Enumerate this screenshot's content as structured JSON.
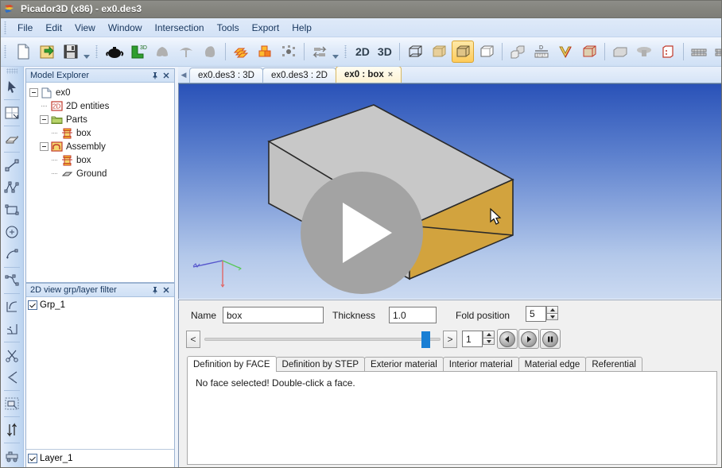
{
  "window": {
    "title": "Picador3D (x86) - ex0.des3",
    "app_icon": "picador-logo-icon"
  },
  "menu": {
    "items": [
      {
        "label": "File",
        "name": "menu-file"
      },
      {
        "label": "Edit",
        "name": "menu-edit"
      },
      {
        "label": "View",
        "name": "menu-view"
      },
      {
        "label": "Window",
        "name": "menu-window"
      },
      {
        "label": "Intersection",
        "name": "menu-intersection"
      },
      {
        "label": "Tools",
        "name": "menu-tools"
      },
      {
        "label": "Export",
        "name": "menu-export"
      },
      {
        "label": "Help",
        "name": "menu-help"
      }
    ]
  },
  "toolbar": {
    "label_2d": "2D",
    "label_3d": "3D",
    "groups": [
      {
        "name": "file-group",
        "icons": [
          "new-document-icon",
          "open-folder-icon",
          "save-disk-icon"
        ]
      },
      {
        "name": "model-group",
        "icons": [
          "teapot-icon",
          "extrude-3d-icon",
          "shape-gray-icon",
          "umbrella-shape-icon",
          "blob-shape-icon"
        ]
      },
      {
        "name": "stack-group",
        "icons": [
          "stacked-sheets-icon",
          "blocks-orange-icon",
          "scatter-points-icon"
        ]
      },
      {
        "name": "swap-group",
        "icons": [
          "swap-arrows-icon"
        ]
      },
      {
        "name": "view-mode-group",
        "icons": [
          "wireframe-cube-icon",
          "shaded-cube-icon",
          "shaded-edges-cube-icon",
          "white-cube-icon"
        ]
      },
      {
        "name": "arrange-group",
        "icons": [
          "multi-cube-icon",
          "dimension-ruler-icon",
          "fold-v-icon",
          "bounding-cube-icon"
        ]
      },
      {
        "name": "solid-group",
        "icons": [
          "solid-block-icon",
          "mushroom-shape-icon",
          "red-box-icon"
        ]
      },
      {
        "name": "bend-group",
        "icons": [
          "bend-table-icon",
          "bend-table2-icon"
        ]
      },
      {
        "name": "measure-group",
        "icons": [
          "angle-measure-icon",
          "eye-view-icon"
        ]
      }
    ],
    "active_view_icon": "shaded-edges-cube-icon"
  },
  "left_tools": {
    "items": [
      {
        "name": "select-arrow-tool",
        "icon": "cursor-arrow-icon"
      },
      {
        "name": "resize-frame-tool",
        "icon": "resize-frame-icon"
      },
      {
        "name": "eraser-tool",
        "icon": "eraser-icon"
      },
      {
        "name": "line-tool",
        "icon": "line-segment-icon"
      },
      {
        "name": "polyline-tool",
        "icon": "polyline-icon"
      },
      {
        "name": "rectangle-tool",
        "icon": "rectangle-icon"
      },
      {
        "name": "circle-tool",
        "icon": "circle-center-icon"
      },
      {
        "name": "arc-tool",
        "icon": "arc-icon"
      },
      {
        "name": "spline-tool",
        "icon": "spline-curve-icon"
      },
      {
        "name": "fillet-tool",
        "icon": "corner-fillet-icon"
      },
      {
        "name": "round-corner-tool",
        "icon": "round-corner-icon"
      },
      {
        "name": "trim-tool",
        "icon": "scissors-icon"
      },
      {
        "name": "chamfer-tool",
        "icon": "chamfer-icon"
      },
      {
        "name": "group-select-tool",
        "icon": "group-select-icon"
      },
      {
        "name": "mirror-tool",
        "icon": "flip-vertical-icon"
      },
      {
        "name": "machine-tool",
        "icon": "machine-icon"
      }
    ]
  },
  "panels": {
    "model_explorer": {
      "title": "Model Explorer",
      "pin_icon": "pin-icon",
      "close_icon": "close-icon",
      "tree": [
        {
          "label": "ex0",
          "icon": "document-icon",
          "depth": 0,
          "expander": "minus",
          "name": "tree-node-ex0"
        },
        {
          "label": "2D entities",
          "icon": "2d-entities-icon",
          "depth": 1,
          "expander": "dash",
          "name": "tree-node-2d-entities"
        },
        {
          "label": "Parts",
          "icon": "folder-icon",
          "depth": 1,
          "expander": "minus",
          "name": "tree-node-parts"
        },
        {
          "label": "box",
          "icon": "part-box-icon",
          "depth": 2,
          "expander": "dash",
          "name": "tree-node-parts-box"
        },
        {
          "label": "Assembly",
          "icon": "assembly-icon",
          "depth": 1,
          "expander": "minus",
          "name": "tree-node-assembly"
        },
        {
          "label": "box",
          "icon": "part-box-icon",
          "depth": 2,
          "expander": "dash",
          "name": "tree-node-assembly-box"
        },
        {
          "label": "Ground",
          "icon": "ground-plane-icon",
          "depth": 2,
          "expander": "dash",
          "name": "tree-node-ground"
        }
      ]
    },
    "layer_filter": {
      "title": "2D view grp/layer filter",
      "pin_icon": "pin-icon",
      "close_icon": "close-icon",
      "groups": [
        {
          "label": "Grp_1",
          "checked": true,
          "name": "group-checkbox-grp1"
        }
      ],
      "layers": [
        {
          "label": "Layer_1",
          "checked": true,
          "name": "layer-checkbox-layer1"
        }
      ]
    }
  },
  "document_tabs": {
    "scroll_left_icon": "chevron-left-icon",
    "items": [
      {
        "label": "ex0.des3 : 3D",
        "active": false,
        "name": "doc-tab-ex0-3d"
      },
      {
        "label": "ex0.des3 : 2D",
        "active": false,
        "name": "doc-tab-ex0-2d"
      },
      {
        "label": "ex0 : box",
        "active": true,
        "name": "doc-tab-ex0-box",
        "closable": true
      }
    ],
    "close_glyph": "×"
  },
  "viewport": {
    "name": "3d-viewport",
    "bg_top": "#2a52b8",
    "bg_bottom": "#cbdaf1",
    "face_color": "#c6c6c6",
    "highlight_face_color": "#d4a847",
    "axes": {
      "x_color": "#e06666",
      "y_color": "#5ac85a",
      "z_color": "#5555cc"
    },
    "cursor_icon": "mouse-pointer-icon"
  },
  "play_overlay": {
    "name": "play-video-overlay",
    "icon": "play-triangle-icon",
    "circle_color": "#a3a3a3",
    "triangle_color": "#ffffff"
  },
  "properties": {
    "name_label": "Name",
    "name_value": "box",
    "thickness_label": "Thickness",
    "thickness_value": "1.0",
    "fold_position_label": "Fold position",
    "fold_position_value": "5",
    "step_value": "1",
    "slider_prev_label": "<",
    "slider_next_label": ">",
    "slider_percent": 97,
    "playback": {
      "prev_icon": "play-back-icon",
      "play_icon": "play-forward-icon",
      "pause_icon": "pause-icon"
    }
  },
  "inner_tabs": {
    "items": [
      {
        "label": "Definition by FACE",
        "active": true,
        "name": "inner-tab-definition-by-face"
      },
      {
        "label": "Definition by STEP",
        "active": false,
        "name": "inner-tab-definition-by-step"
      },
      {
        "label": "Exterior material",
        "active": false,
        "name": "inner-tab-exterior-material"
      },
      {
        "label": "Interior material",
        "active": false,
        "name": "inner-tab-interior-material"
      },
      {
        "label": "Material edge",
        "active": false,
        "name": "inner-tab-material-edge"
      },
      {
        "label": "Referential",
        "active": false,
        "name": "inner-tab-referential"
      }
    ],
    "body_message": "No face selected! Double-click a face."
  }
}
